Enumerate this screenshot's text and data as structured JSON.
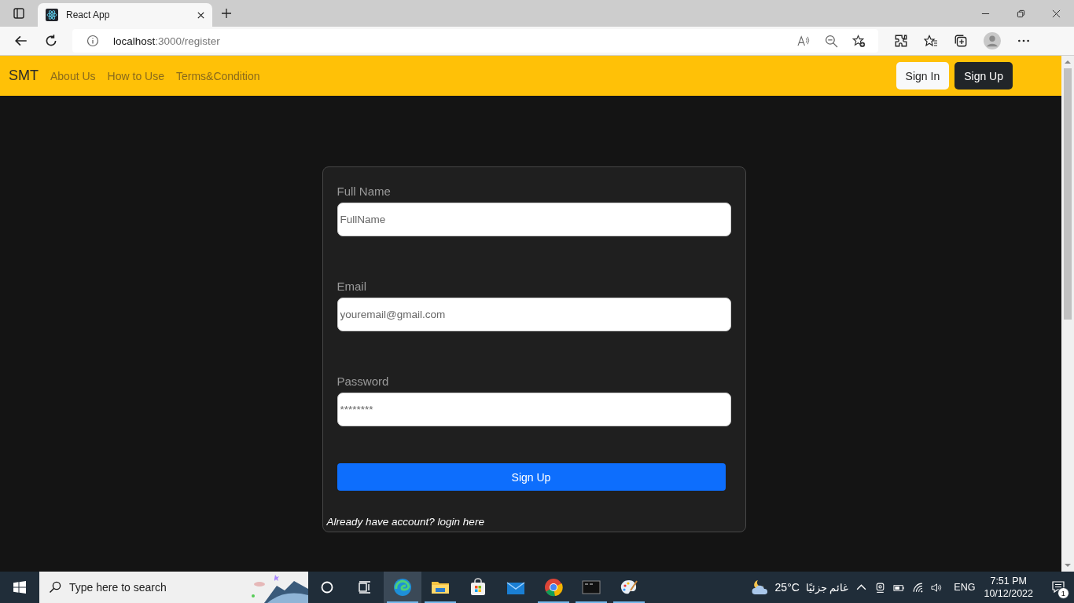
{
  "browser": {
    "tab_title": "React App",
    "address_host": "localhost",
    "address_path": ":3000/register"
  },
  "navbar": {
    "brand": "SMT",
    "links": [
      "About Us",
      "How to Use",
      "Terms&Condition"
    ],
    "buttons": [
      {
        "label": "Sign In",
        "kind": "light"
      },
      {
        "label": "Sign Up",
        "kind": "dark"
      }
    ]
  },
  "form": {
    "fields": [
      {
        "label": "Full Name",
        "placeholder": "FullName"
      },
      {
        "label": "Email",
        "placeholder": "youremail@gmail.com"
      },
      {
        "label": "Password",
        "placeholder": "********"
      }
    ],
    "submit": "Sign Up",
    "footer": "Already have account? login here"
  },
  "taskbar": {
    "search_placeholder": "Type here to search",
    "apps": [
      {
        "kind": "edge",
        "selected": true,
        "running": true
      },
      {
        "kind": "folder",
        "selected": false,
        "running": true
      },
      {
        "kind": "store",
        "selected": false,
        "running": false
      },
      {
        "kind": "mail",
        "selected": false,
        "running": false
      },
      {
        "kind": "chrome",
        "selected": false,
        "running": true
      },
      {
        "kind": "terminal",
        "selected": false,
        "running": true
      },
      {
        "kind": "paint",
        "selected": false,
        "running": true
      }
    ],
    "temperature": "25°C",
    "weather": "غائم جزئيًا",
    "language": "ENG",
    "time": "7:51 PM",
    "date": "10/12/2022",
    "notifications": "1"
  }
}
